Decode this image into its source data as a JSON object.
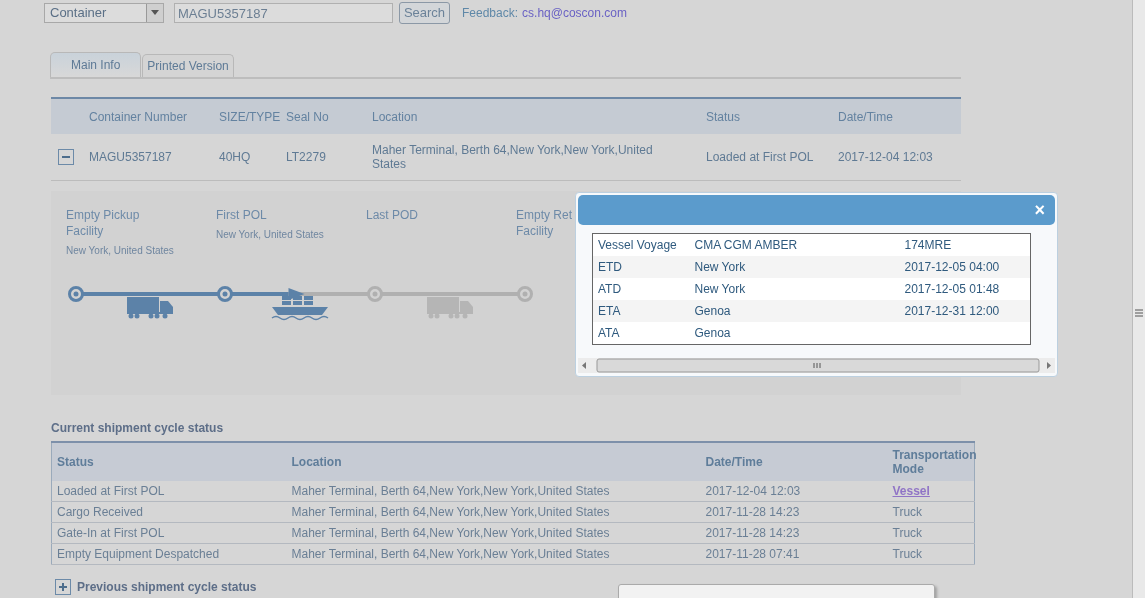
{
  "search_bar": {
    "type_select": "Container",
    "query": "MAGU5357187",
    "search_button": "Search",
    "feedback_label": "Feedback:",
    "feedback_email": "cs.hq@coscon.com"
  },
  "tabs": [
    {
      "label": "Main Info",
      "selected": true
    },
    {
      "label": "Printed Version",
      "selected": false
    }
  ],
  "container_table": {
    "columns": [
      "Container Number",
      "SIZE/TYPE",
      "Seal No",
      "Location",
      "Status",
      "Date/Time"
    ],
    "rows": [
      {
        "expanded": true,
        "cells": [
          "MAGU5357187",
          "40HQ",
          "LT2279",
          "Maher Terminal, Berth 64,New York,New York,United States",
          "Loaded at First POL",
          "2017-12-04 12:03"
        ]
      }
    ]
  },
  "route": {
    "stages": [
      {
        "name": "Empty Pickup Facility",
        "location": "New York, United States",
        "reached": true
      },
      {
        "name": "First POL",
        "location": "New York, United States",
        "reached": true
      },
      {
        "name": "Last POD",
        "reached": false
      },
      {
        "name": "Empty Ret Facility",
        "reached": false
      }
    ],
    "level": 0.51,
    "legs": [
      {
        "kind": "truck"
      },
      {
        "kind": "ship"
      },
      {
        "kind": "truck"
      }
    ]
  },
  "cycle": {
    "title": "Current shipment cycle status",
    "columns": [
      "Status",
      "Location",
      "Date/Time",
      "Transportation Mode"
    ],
    "rows": [
      {
        "status": "Loaded at First POL",
        "location": "Maher Terminal, Berth 64,New York,New York,United States",
        "time": "2017-12-04 12:03",
        "mode": "Vessel",
        "mode_link": true
      },
      {
        "status": "Cargo Received",
        "location": "Maher Terminal, Berth 64,New York,New York,United States",
        "time": "2017-11-28 14:23",
        "mode": "Truck",
        "mode_link": false
      },
      {
        "status": "Gate-In at First POL",
        "location": "Maher Terminal, Berth 64,New York,New York,United States",
        "time": "2017-11-28 14:23",
        "mode": "Truck",
        "mode_link": false
      },
      {
        "status": "Empty Equipment Despatched",
        "location": "Maher Terminal, Berth 64,New York,New York,United States",
        "time": "2017-11-28 07:41",
        "mode": "Truck",
        "mode_link": false
      }
    ]
  },
  "previous": {
    "label": "Previous shipment cycle status",
    "expanded": false
  },
  "vessel_popup": {
    "close": "×",
    "rows": [
      [
        "Vessel Voyage",
        "CMA CGM AMBER",
        "174MRE"
      ],
      [
        "ETD",
        "New York",
        "2017-12-05 04:00"
      ],
      [
        "ATD",
        "New York",
        "2017-12-05 01:48"
      ],
      [
        "ETA",
        "Genoa",
        "2017-12-31 12:00"
      ],
      [
        "ATA",
        "Genoa"
      ]
    ]
  }
}
